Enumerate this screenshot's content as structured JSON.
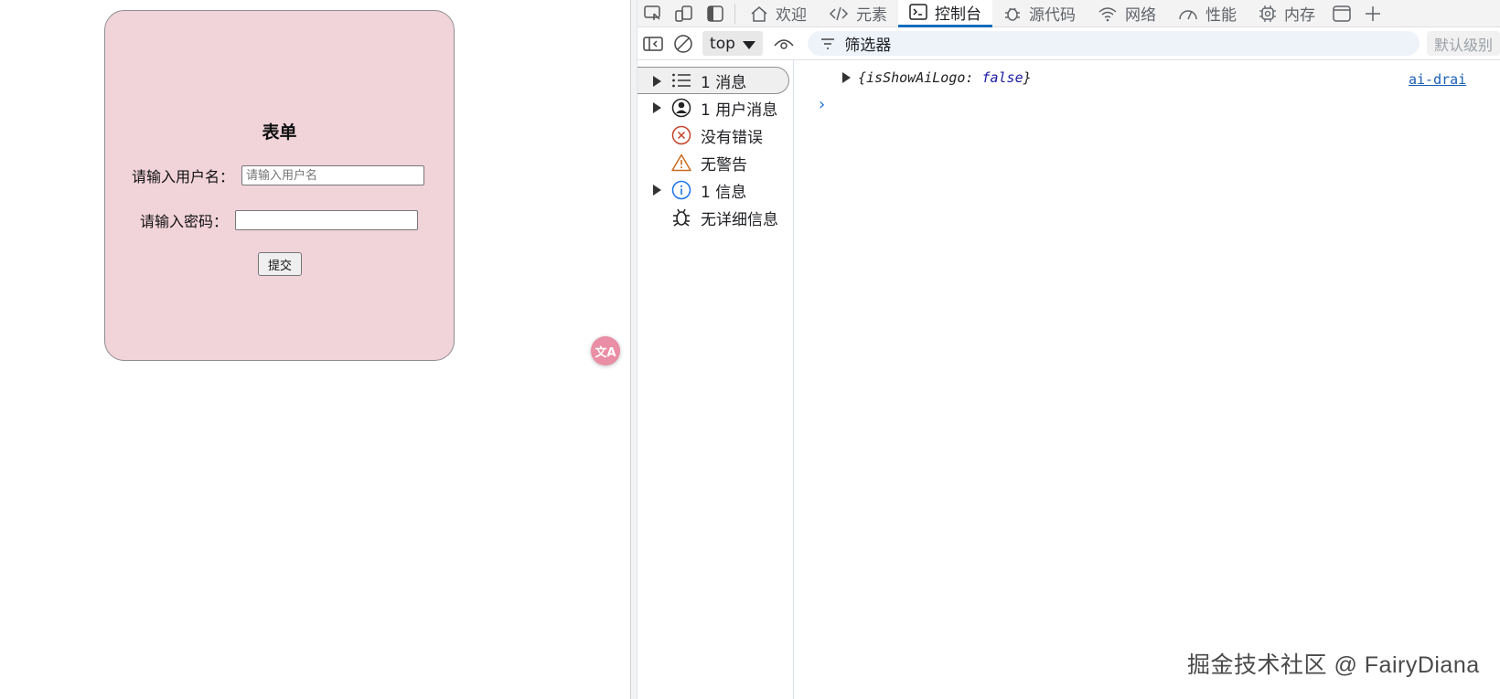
{
  "form": {
    "title": "表单",
    "username_label": "请输入用户名：",
    "username_placeholder": "请输入用户名",
    "username_value": "",
    "password_label": "请输入密码：",
    "password_value": "",
    "submit_label": "提交"
  },
  "translate_fab": {
    "icon": "translate-icon",
    "glyph": "文A",
    "color": "#e98ea4"
  },
  "devtools": {
    "tabs": [
      {
        "label": "欢迎",
        "icon": "home-icon",
        "active": false
      },
      {
        "label": "元素",
        "icon": "code-icon",
        "active": false
      },
      {
        "label": "控制台",
        "icon": "console-icon",
        "active": true
      },
      {
        "label": "源代码",
        "icon": "bug-icon",
        "active": false
      },
      {
        "label": "网络",
        "icon": "wifi-icon",
        "active": false
      },
      {
        "label": "性能",
        "icon": "gauge-icon",
        "active": false
      },
      {
        "label": "内存",
        "icon": "chip-icon",
        "active": false
      }
    ],
    "toolbar": {
      "context": "top",
      "filter_placeholder": "筛选器",
      "levels": "默认级别"
    },
    "sidebar": [
      {
        "label": "1 消息",
        "icon": "list-icon",
        "expandable": true,
        "selected": true
      },
      {
        "label": "1 用户消息",
        "icon": "user-icon",
        "expandable": true,
        "selected": false
      },
      {
        "label": "没有错误",
        "icon": "error-icon",
        "expandable": false,
        "selected": false
      },
      {
        "label": "无警告",
        "icon": "warning-icon",
        "expandable": false,
        "selected": false
      },
      {
        "label": "1 信息",
        "icon": "info-icon",
        "expandable": true,
        "selected": false
      },
      {
        "label": "无详细信息",
        "icon": "bug-icon",
        "expandable": false,
        "selected": false
      }
    ],
    "log": {
      "object_open": "{",
      "key": "isShowAiLogo",
      "sep": ": ",
      "value": "false",
      "object_close": "}",
      "source": "ai-drai"
    },
    "accent_color": "#0f6cbd"
  },
  "watermark": "掘金技术社区 @ FairyDiana"
}
